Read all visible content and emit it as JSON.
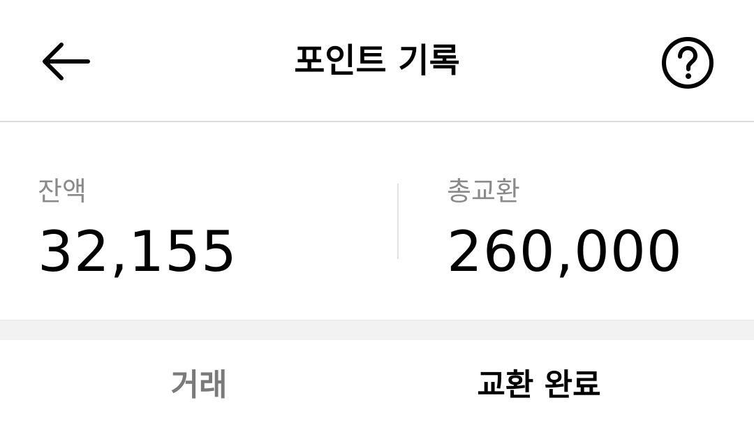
{
  "header": {
    "title": "포인트 기록",
    "back_icon": "arrow-left-icon",
    "help_icon": "question-circle-icon"
  },
  "summary": {
    "balance": {
      "label": "잔액",
      "value": "32,155"
    },
    "total_exchange": {
      "label": "총교환",
      "value": "260,000"
    }
  },
  "tabs": [
    {
      "label": "거래",
      "active": false
    },
    {
      "label": "교환 완료",
      "active": true
    }
  ],
  "colors": {
    "text_primary": "#000000",
    "text_secondary": "#8a8a8a",
    "divider": "#dcdcdc",
    "band": "#f2f2f2"
  }
}
